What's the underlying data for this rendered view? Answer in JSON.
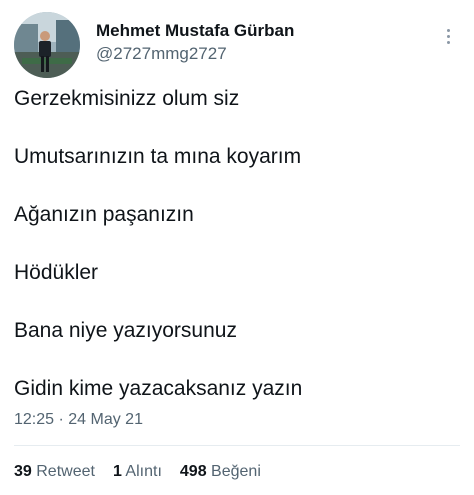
{
  "author": {
    "display_name": "Mehmet Mustafa Gürban",
    "handle": "@2727mmg2727"
  },
  "tweet": {
    "lines": [
      "Gerzekmisinizz olum siz",
      "Umutsarınızın ta mına koyarım",
      "Ağanızın paşanızın",
      "Hödükler",
      "Bana niye yazıyorsunuz",
      "Gidin kime yazacaksanız yazın"
    ],
    "time": "12:25 · 24 May 21"
  },
  "stats": {
    "retweets_count": "39",
    "retweets_label": "Retweet",
    "quotes_count": "1",
    "quotes_label": "Alıntı",
    "likes_count": "498",
    "likes_label": "Beğeni"
  },
  "icons": {
    "more": "more-vertical-icon"
  },
  "colors": {
    "text": "#0f1419",
    "secondary": "#536471",
    "divider": "#e6ecf0"
  }
}
